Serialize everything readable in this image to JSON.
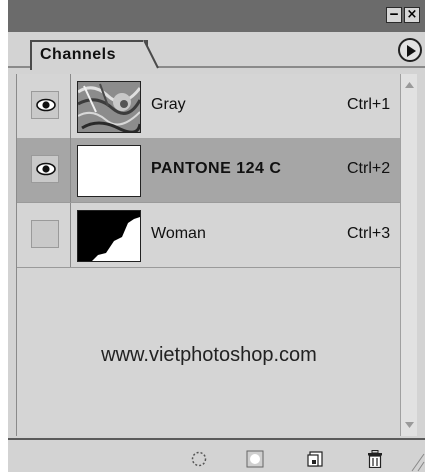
{
  "window": {
    "minimize_icon": "minimize-icon",
    "minimize_glyph": "‒",
    "close_icon": "close-icon",
    "close_glyph": "×"
  },
  "panel": {
    "tab_label": "Channels",
    "menu_icon": "panel-menu-arrow-icon"
  },
  "channels": [
    {
      "name": "Gray",
      "shortcut": "Ctrl+1",
      "visible": true,
      "selected": false,
      "thumbnail": "gray-photo-thumbnail"
    },
    {
      "name": "PANTONE 124 C",
      "shortcut": "Ctrl+2",
      "visible": true,
      "selected": true,
      "thumbnail": "white-spot-color-thumbnail"
    },
    {
      "name": "Woman",
      "shortcut": "Ctrl+3",
      "visible": false,
      "selected": false,
      "thumbnail": "black-white-mask-thumbnail"
    }
  ],
  "watermark": "www.vietphotoshop.com",
  "bottom_toolbar": [
    {
      "icon": "load-channel-as-selection-icon"
    },
    {
      "icon": "save-selection-as-channel-icon"
    },
    {
      "icon": "new-channel-icon"
    },
    {
      "icon": "delete-channel-icon"
    }
  ],
  "colors": {
    "panel_bg": "#d3d3d3",
    "titlebar_bg": "#6b6b6b",
    "selected_row": "#a6a6a6"
  }
}
